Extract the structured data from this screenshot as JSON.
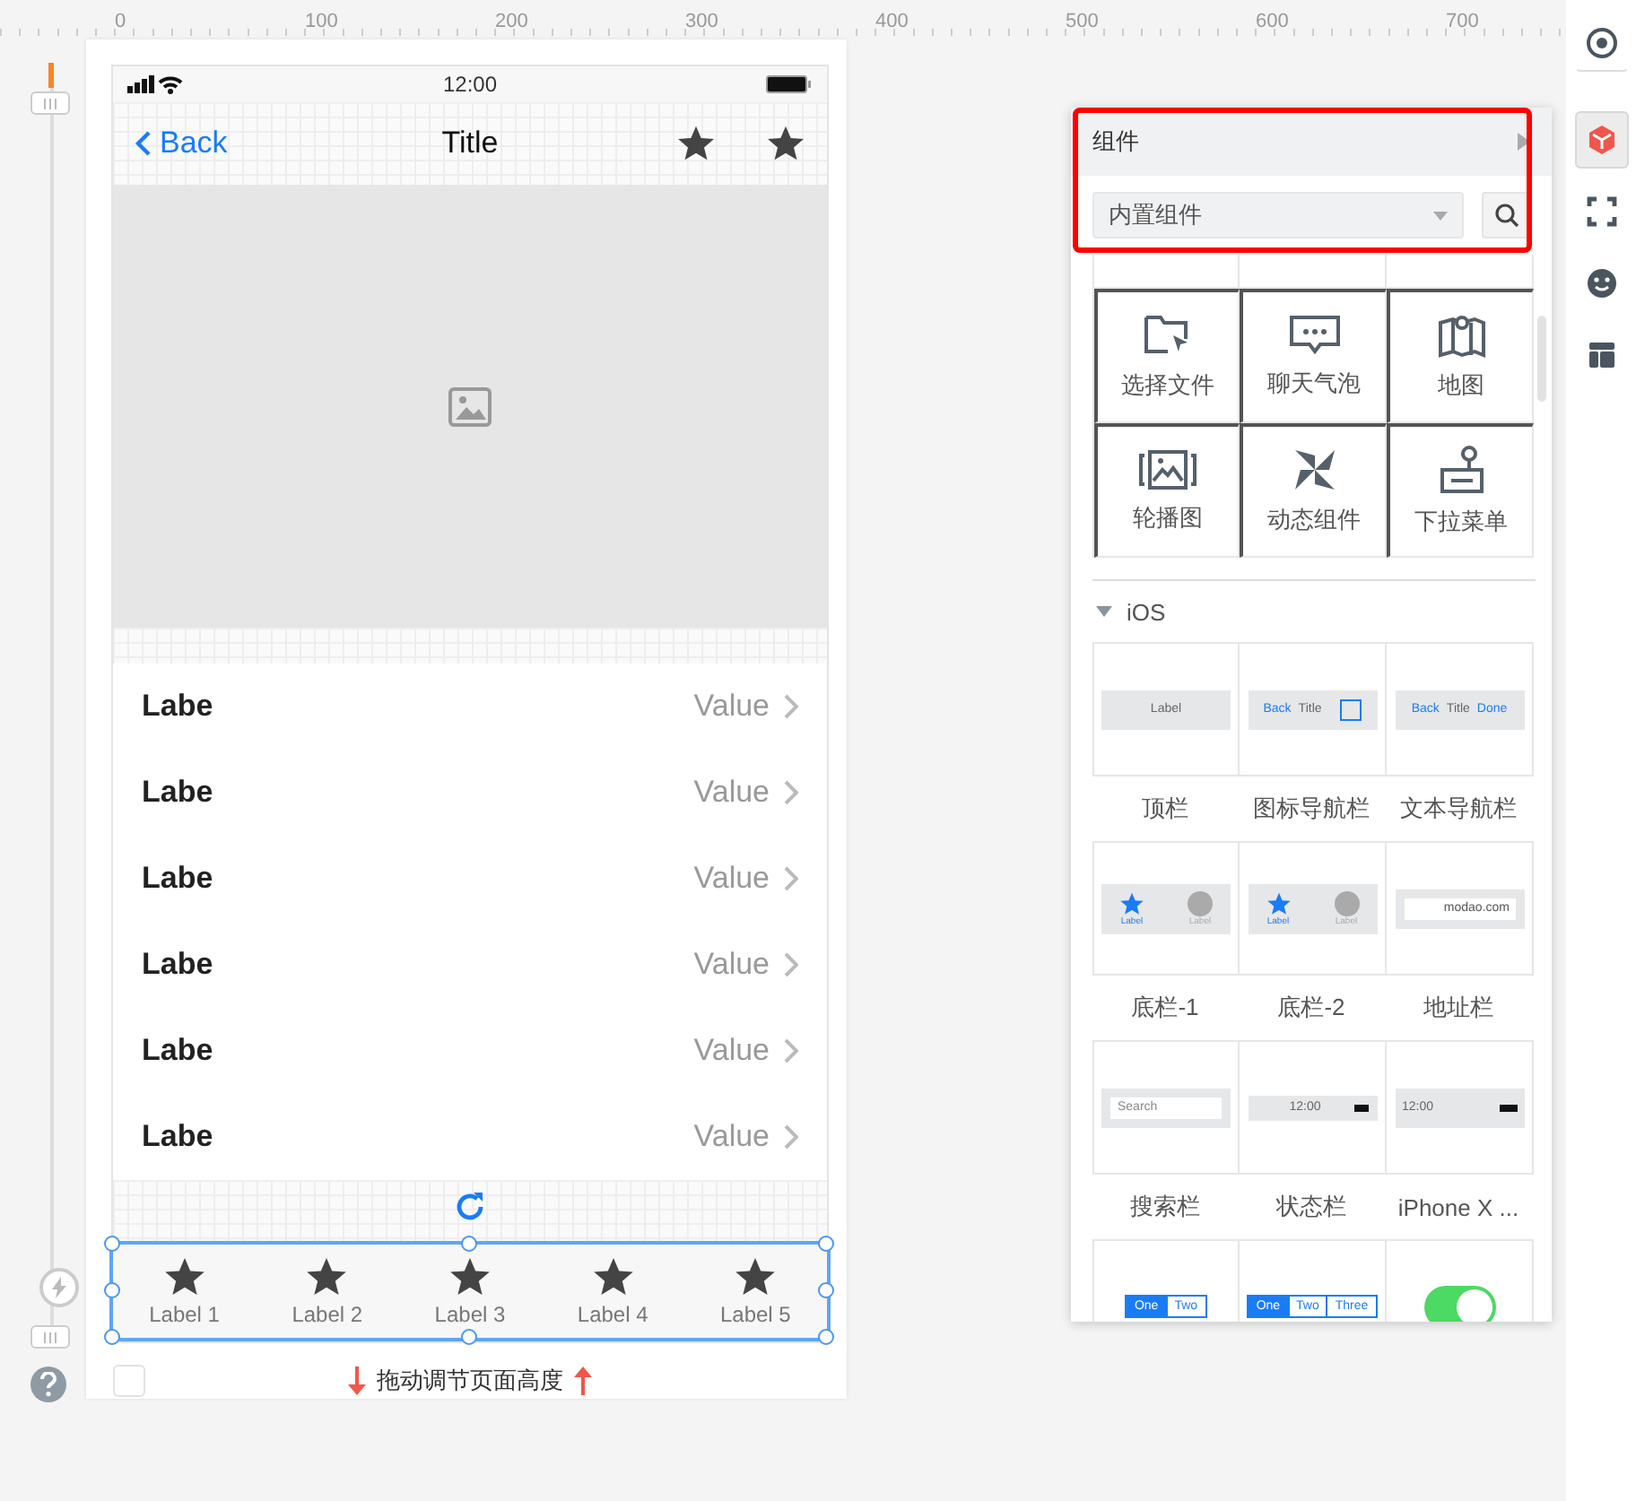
{
  "ruler": {
    "ticks": [
      "0",
      "100",
      "200",
      "300",
      "400",
      "500",
      "600",
      "700"
    ]
  },
  "toolbar": {
    "items": [
      {
        "kind": "target",
        "selected": false
      },
      {
        "kind": "cube",
        "selected": true
      },
      {
        "kind": "scan",
        "selected": false
      },
      {
        "kind": "face",
        "selected": false
      },
      {
        "kind": "layout",
        "selected": false
      }
    ]
  },
  "phone": {
    "status_bar": {
      "time": "12:00"
    },
    "nav_bar": {
      "back": "Back",
      "title": "Title"
    },
    "list": [
      {
        "label": "Labe",
        "value": "Value"
      },
      {
        "label": "Labe",
        "value": "Value"
      },
      {
        "label": "Labe",
        "value": "Value"
      },
      {
        "label": "Labe",
        "value": "Value"
      },
      {
        "label": "Labe",
        "value": "Value"
      },
      {
        "label": "Labe",
        "value": "Value"
      }
    ],
    "tab_bar": {
      "selected": true,
      "tabs": [
        {
          "label": "Label 1"
        },
        {
          "label": "Label 2"
        },
        {
          "label": "Label 3"
        },
        {
          "label": "Label 4"
        },
        {
          "label": "Label 5"
        }
      ]
    },
    "hint": "拖动调节页面高度",
    "checkbox": {
      "checked": false
    }
  },
  "panel": {
    "title": "组件",
    "dropdown": {
      "value": "内置组件"
    },
    "custom_items": [
      {
        "label": "选择文件",
        "kind": "folder"
      },
      {
        "label": "聊天气泡",
        "kind": "chat"
      },
      {
        "label": "地图",
        "kind": "map"
      },
      {
        "label": "轮播图",
        "kind": "carousel"
      },
      {
        "label": "动态组件",
        "kind": "pinwheel"
      },
      {
        "label": "下拉菜单",
        "kind": "dropdown"
      }
    ],
    "sections": [
      {
        "title": "iOS",
        "expanded": true,
        "items": [
          {
            "label": "顶栏",
            "preview": {
              "kind": "topbar",
              "texts": [
                "Label"
              ]
            }
          },
          {
            "label": "图标导航栏",
            "preview": {
              "kind": "iconnav",
              "texts": [
                "Back",
                "Title"
              ]
            }
          },
          {
            "label": "文本导航栏",
            "preview": {
              "kind": "textnav",
              "texts": [
                "Back",
                "Title",
                "Done"
              ]
            }
          },
          {
            "label": "底栏-1",
            "preview": {
              "kind": "tabbar",
              "texts": [
                "Label",
                "Label"
              ]
            }
          },
          {
            "label": "底栏-2",
            "preview": {
              "kind": "tabbar",
              "texts": [
                "Label",
                "Label"
              ]
            }
          },
          {
            "label": "地址栏",
            "preview": {
              "kind": "address",
              "texts": [
                "modao.com"
              ]
            }
          },
          {
            "label": "搜索栏",
            "preview": {
              "kind": "search",
              "texts": [
                "Search"
              ]
            }
          },
          {
            "label": "状态栏",
            "preview": {
              "kind": "status",
              "texts": [
                "12:00"
              ]
            }
          },
          {
            "label": "iPhone X ...",
            "preview": {
              "kind": "statusx",
              "texts": [
                "12:00"
              ]
            }
          },
          {
            "preview": {
              "kind": "segment",
              "texts": [
                "One",
                "Two"
              ]
            }
          },
          {
            "preview": {
              "kind": "segment",
              "texts": [
                "One",
                "Two",
                "Three"
              ]
            }
          },
          {
            "preview": {
              "kind": "switch",
              "on": true
            }
          }
        ]
      }
    ]
  }
}
